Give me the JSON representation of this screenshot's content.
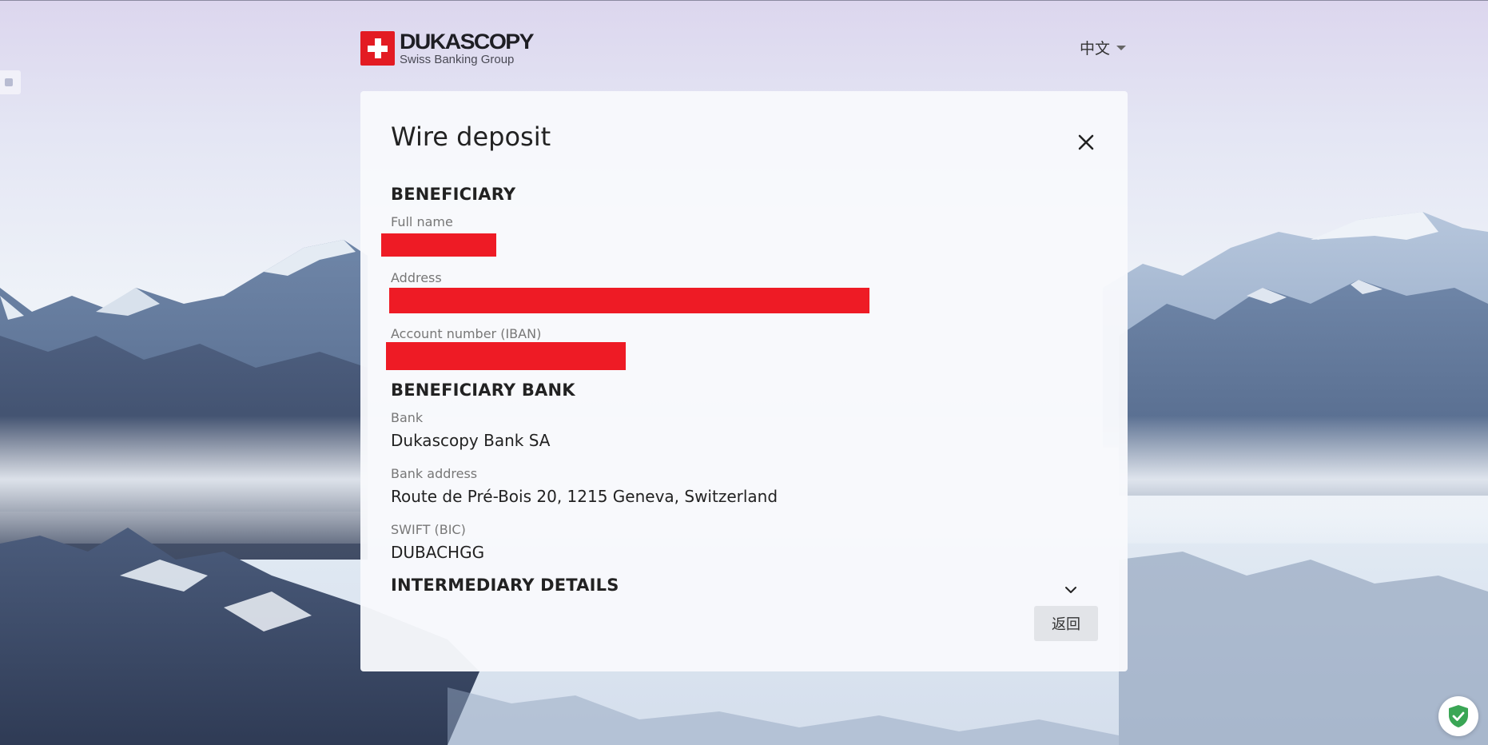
{
  "header": {
    "logo_name": "DUKASCOPY",
    "logo_tagline": "Swiss Banking Group",
    "language": "中文"
  },
  "dialog": {
    "title": "Wire deposit",
    "beneficiary": {
      "heading": "BENEFICIARY",
      "full_name_label": "Full name",
      "address_label": "Address",
      "account_label": "Account number (IBAN)"
    },
    "beneficiary_bank": {
      "heading": "BENEFICIARY BANK",
      "bank_label": "Bank",
      "bank_value": "Dukascopy Bank SA",
      "bank_address_label": "Bank address",
      "bank_address_value": "Route de Pré-Bois 20, 1215 Geneva, Switzerland",
      "swift_label": "SWIFT (BIC)",
      "swift_value": "DUBACHGG"
    },
    "intermediary": {
      "heading": "INTERMEDIARY DETAILS"
    },
    "back_label": "返回"
  },
  "colors": {
    "brand_red": "#e31b23",
    "redaction": "#ee1b25",
    "shield_green": "#3aa655"
  },
  "icons": {
    "close": "close-icon",
    "expand": "chevron-down-icon",
    "language": "caret-down-icon",
    "security": "shield-check-icon"
  }
}
